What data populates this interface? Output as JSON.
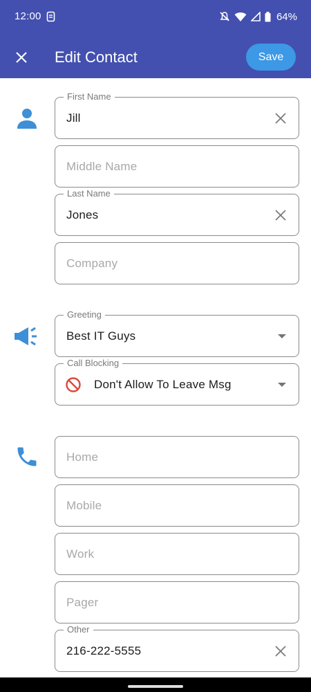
{
  "status_bar": {
    "time": "12:00",
    "battery": "64%"
  },
  "header": {
    "title": "Edit Contact",
    "save_label": "Save",
    "close_icon": "close-icon"
  },
  "name_section": {
    "icon": "person-icon",
    "first_name": {
      "label": "First Name",
      "value": "Jill"
    },
    "middle_name": {
      "placeholder": "Middle Name"
    },
    "last_name": {
      "label": "Last Name",
      "value": "Jones"
    },
    "company": {
      "placeholder": "Company"
    }
  },
  "greeting_section": {
    "icon": "megaphone-icon",
    "greeting": {
      "label": "Greeting",
      "value": "Best IT Guys"
    },
    "call_blocking": {
      "label": "Call Blocking",
      "value": "Don't Allow To Leave Msg"
    }
  },
  "phone_section": {
    "icon": "phone-icon",
    "home": {
      "placeholder": "Home"
    },
    "mobile": {
      "placeholder": "Mobile"
    },
    "work": {
      "placeholder": "Work"
    },
    "pager": {
      "placeholder": "Pager"
    },
    "other": {
      "label": "Other",
      "value": "216-222-5555"
    }
  },
  "colors": {
    "app_bar": "#4350af",
    "save_button": "#3d98e6",
    "section_icon": "#3d8fd6",
    "block_icon": "#d94a3a"
  }
}
